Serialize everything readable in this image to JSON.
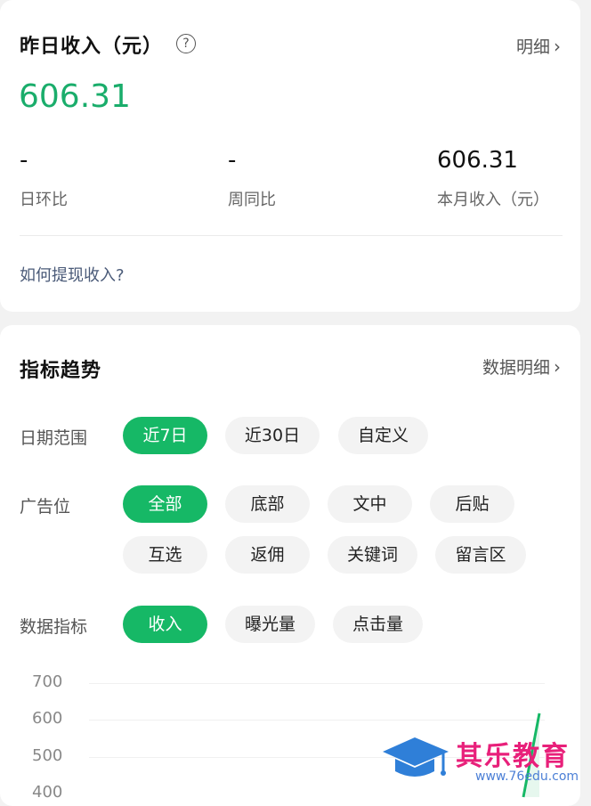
{
  "income": {
    "title": "昨日收入（元）",
    "help_icon": "question-circle-icon",
    "detail_link": "明细",
    "yesterday_amount": "606.31",
    "stats": [
      {
        "value": "-",
        "label": "日环比"
      },
      {
        "value": "-",
        "label": "周同比"
      },
      {
        "value": "606.31",
        "label": "本月收入（元）"
      }
    ],
    "withdraw_link": "如何提现收入?"
  },
  "trend": {
    "title": "指标趋势",
    "data_detail_link": "数据明细",
    "date_range": {
      "label": "日期范围",
      "options": [
        "近7日",
        "近30日",
        "自定义"
      ],
      "selected": "近7日"
    },
    "ad_position": {
      "label": "广告位",
      "options": [
        "全部",
        "底部",
        "文中",
        "后贴",
        "互选",
        "返佣",
        "关键词",
        "留言区"
      ],
      "selected": "全部"
    },
    "metric": {
      "label": "数据指标",
      "options": [
        "收入",
        "曝光量",
        "点击量"
      ],
      "selected": "收入"
    }
  },
  "chart_data": {
    "type": "line",
    "y_ticks": [
      "700",
      "600",
      "500",
      "400"
    ],
    "series_color": "#16b866",
    "visible_trend": "rising to 606.31 at latest day"
  },
  "watermark": {
    "text": "其乐教育",
    "url": "www.76edu.com",
    "icon": "graduation-cap-icon"
  },
  "colors": {
    "accent": "#16b866",
    "amount": "#1aad6b",
    "link": "#4a5a78"
  }
}
